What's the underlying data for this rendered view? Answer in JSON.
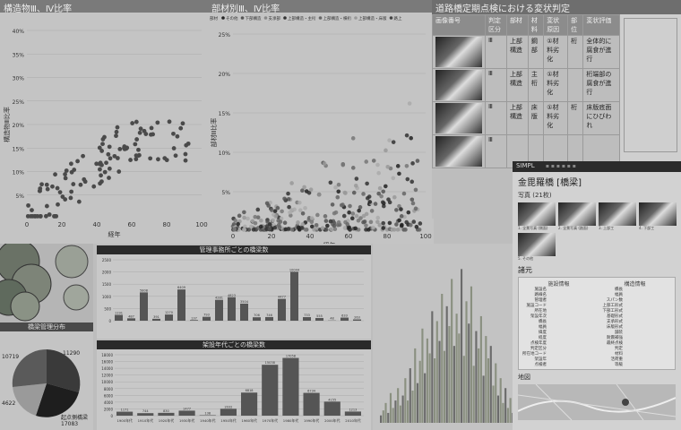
{
  "scatter1": {
    "title": "構造物Ⅲ、Ⅳ比率",
    "ylabel": "構造物Ⅲ比率",
    "xlabel": "経年",
    "yticks": [
      "40%",
      "35%",
      "30%",
      "25%",
      "20%",
      "15%",
      "10%",
      "5%"
    ],
    "xticks": [
      "0",
      "20",
      "40",
      "60",
      "80",
      "100"
    ]
  },
  "scatter2": {
    "title": "部材別Ⅲ、Ⅳ比率",
    "ylabel": "部材Ⅲ比率",
    "xlabel": "経年",
    "legend": [
      "部材",
      "その他",
      "下部構造",
      "支承部",
      "上部構造・主桁",
      "上部構造・横桁",
      "上部構造・床版",
      "路上"
    ],
    "yticks": [
      "25%",
      "20%",
      "15%",
      "10%",
      "5%"
    ],
    "xticks": [
      "0",
      "20",
      "40",
      "60",
      "80",
      "100"
    ]
  },
  "table": {
    "title": "道路橋定期点検における変状判定",
    "headers": [
      "画像番号",
      "判定区分",
      "部材",
      "材料",
      "変状原因",
      "部位",
      "変状評価"
    ],
    "rows": [
      [
        "",
        "Ⅲ",
        "上部構造",
        "鋼部",
        "①材料劣化",
        "桁",
        "全体的に腐食が進行"
      ],
      [
        "",
        "Ⅲ",
        "上部構造",
        "主桁",
        "①材料劣化",
        "",
        "桁端部の腐食が進行"
      ],
      [
        "",
        "Ⅲ",
        "上部構造",
        "床版",
        "①材料劣化",
        "桁",
        "床版底面にひびわれ"
      ],
      [
        "",
        "Ⅲ",
        "",
        "",
        "",
        "",
        ""
      ]
    ]
  },
  "pie": {
    "title": "橋梁管理分布",
    "labels": [
      "11290",
      "10719",
      "4622",
      "17083"
    ],
    "names": [
      "",
      "",
      "",
      "起点側橋梁"
    ]
  },
  "bars1": {
    "title": "管理事務所ごとの橋梁数",
    "yticks": [
      "2500",
      "2000",
      "1500",
      "1000",
      "500",
      "0"
    ],
    "values": [
      1191,
      487,
      5808,
      391,
      1270,
      6409,
      137,
      793,
      4281,
      4823,
      3504,
      706,
      746,
      4477,
      10044,
      733,
      555,
      48,
      633,
      263
    ]
  },
  "bars2": {
    "title": "架設年代ごとの橋梁数",
    "yticks": [
      "18000",
      "16000",
      "14000",
      "12000",
      "10000",
      "8000",
      "6000",
      "4000",
      "2000",
      "0"
    ],
    "values": [
      1171,
      744,
      830,
      1477,
      138,
      2032,
      6818,
      15038,
      17058,
      6734,
      4155,
      1213
    ],
    "categories": [
      "1900年代",
      "1910年代",
      "1920年代",
      "1930年代",
      "1940年代",
      "1950年代",
      "1960年代",
      "1970年代",
      "1980年代",
      "1990年代",
      "2000年代",
      "2010年代"
    ]
  },
  "detail": {
    "topbar": "SIMPL",
    "bridge_name": "金毘羅橋 [橋梁]",
    "photo_label": "写真 (21枚)",
    "spec_title": "諸元",
    "spec_left_title": "施設情報",
    "spec_right_title": "構造情報",
    "map_title": "地図",
    "spec_left": [
      "施設名",
      "路線名",
      "管理者",
      "施設コード",
      "所在地",
      "架設年次",
      "橋長",
      "幅員",
      "緯度",
      "経度",
      "点検年度",
      "判定区分",
      "所在地コード",
      "架設年",
      "点検者"
    ],
    "spec_right": [
      "橋長",
      "幅員",
      "スパン数",
      "上部工形式",
      "下部工形式",
      "基礎形式",
      "支承形式",
      "床版形式",
      "舗装",
      "耐震補強",
      "最終点検",
      "判定",
      "材料",
      "活荷重",
      "等級"
    ],
    "photos": [
      "1. 全景写真 (側面)",
      "2. 全景写真 (路面)",
      "3. 上部工",
      "4. 下部工",
      "5. その他"
    ]
  },
  "bars3": {
    "values": [
      3,
      5,
      8,
      4,
      12,
      6,
      9,
      14,
      7,
      11,
      18,
      9,
      22,
      13,
      30,
      16,
      25,
      38,
      20,
      34,
      28,
      45,
      26,
      41,
      33,
      52,
      29,
      47,
      39,
      58,
      31,
      44,
      36,
      62,
      27,
      49,
      40,
      55,
      23,
      37,
      30,
      43,
      19,
      35,
      26,
      31,
      15,
      24,
      11,
      18,
      8,
      14,
      6,
      10,
      4
    ]
  }
}
